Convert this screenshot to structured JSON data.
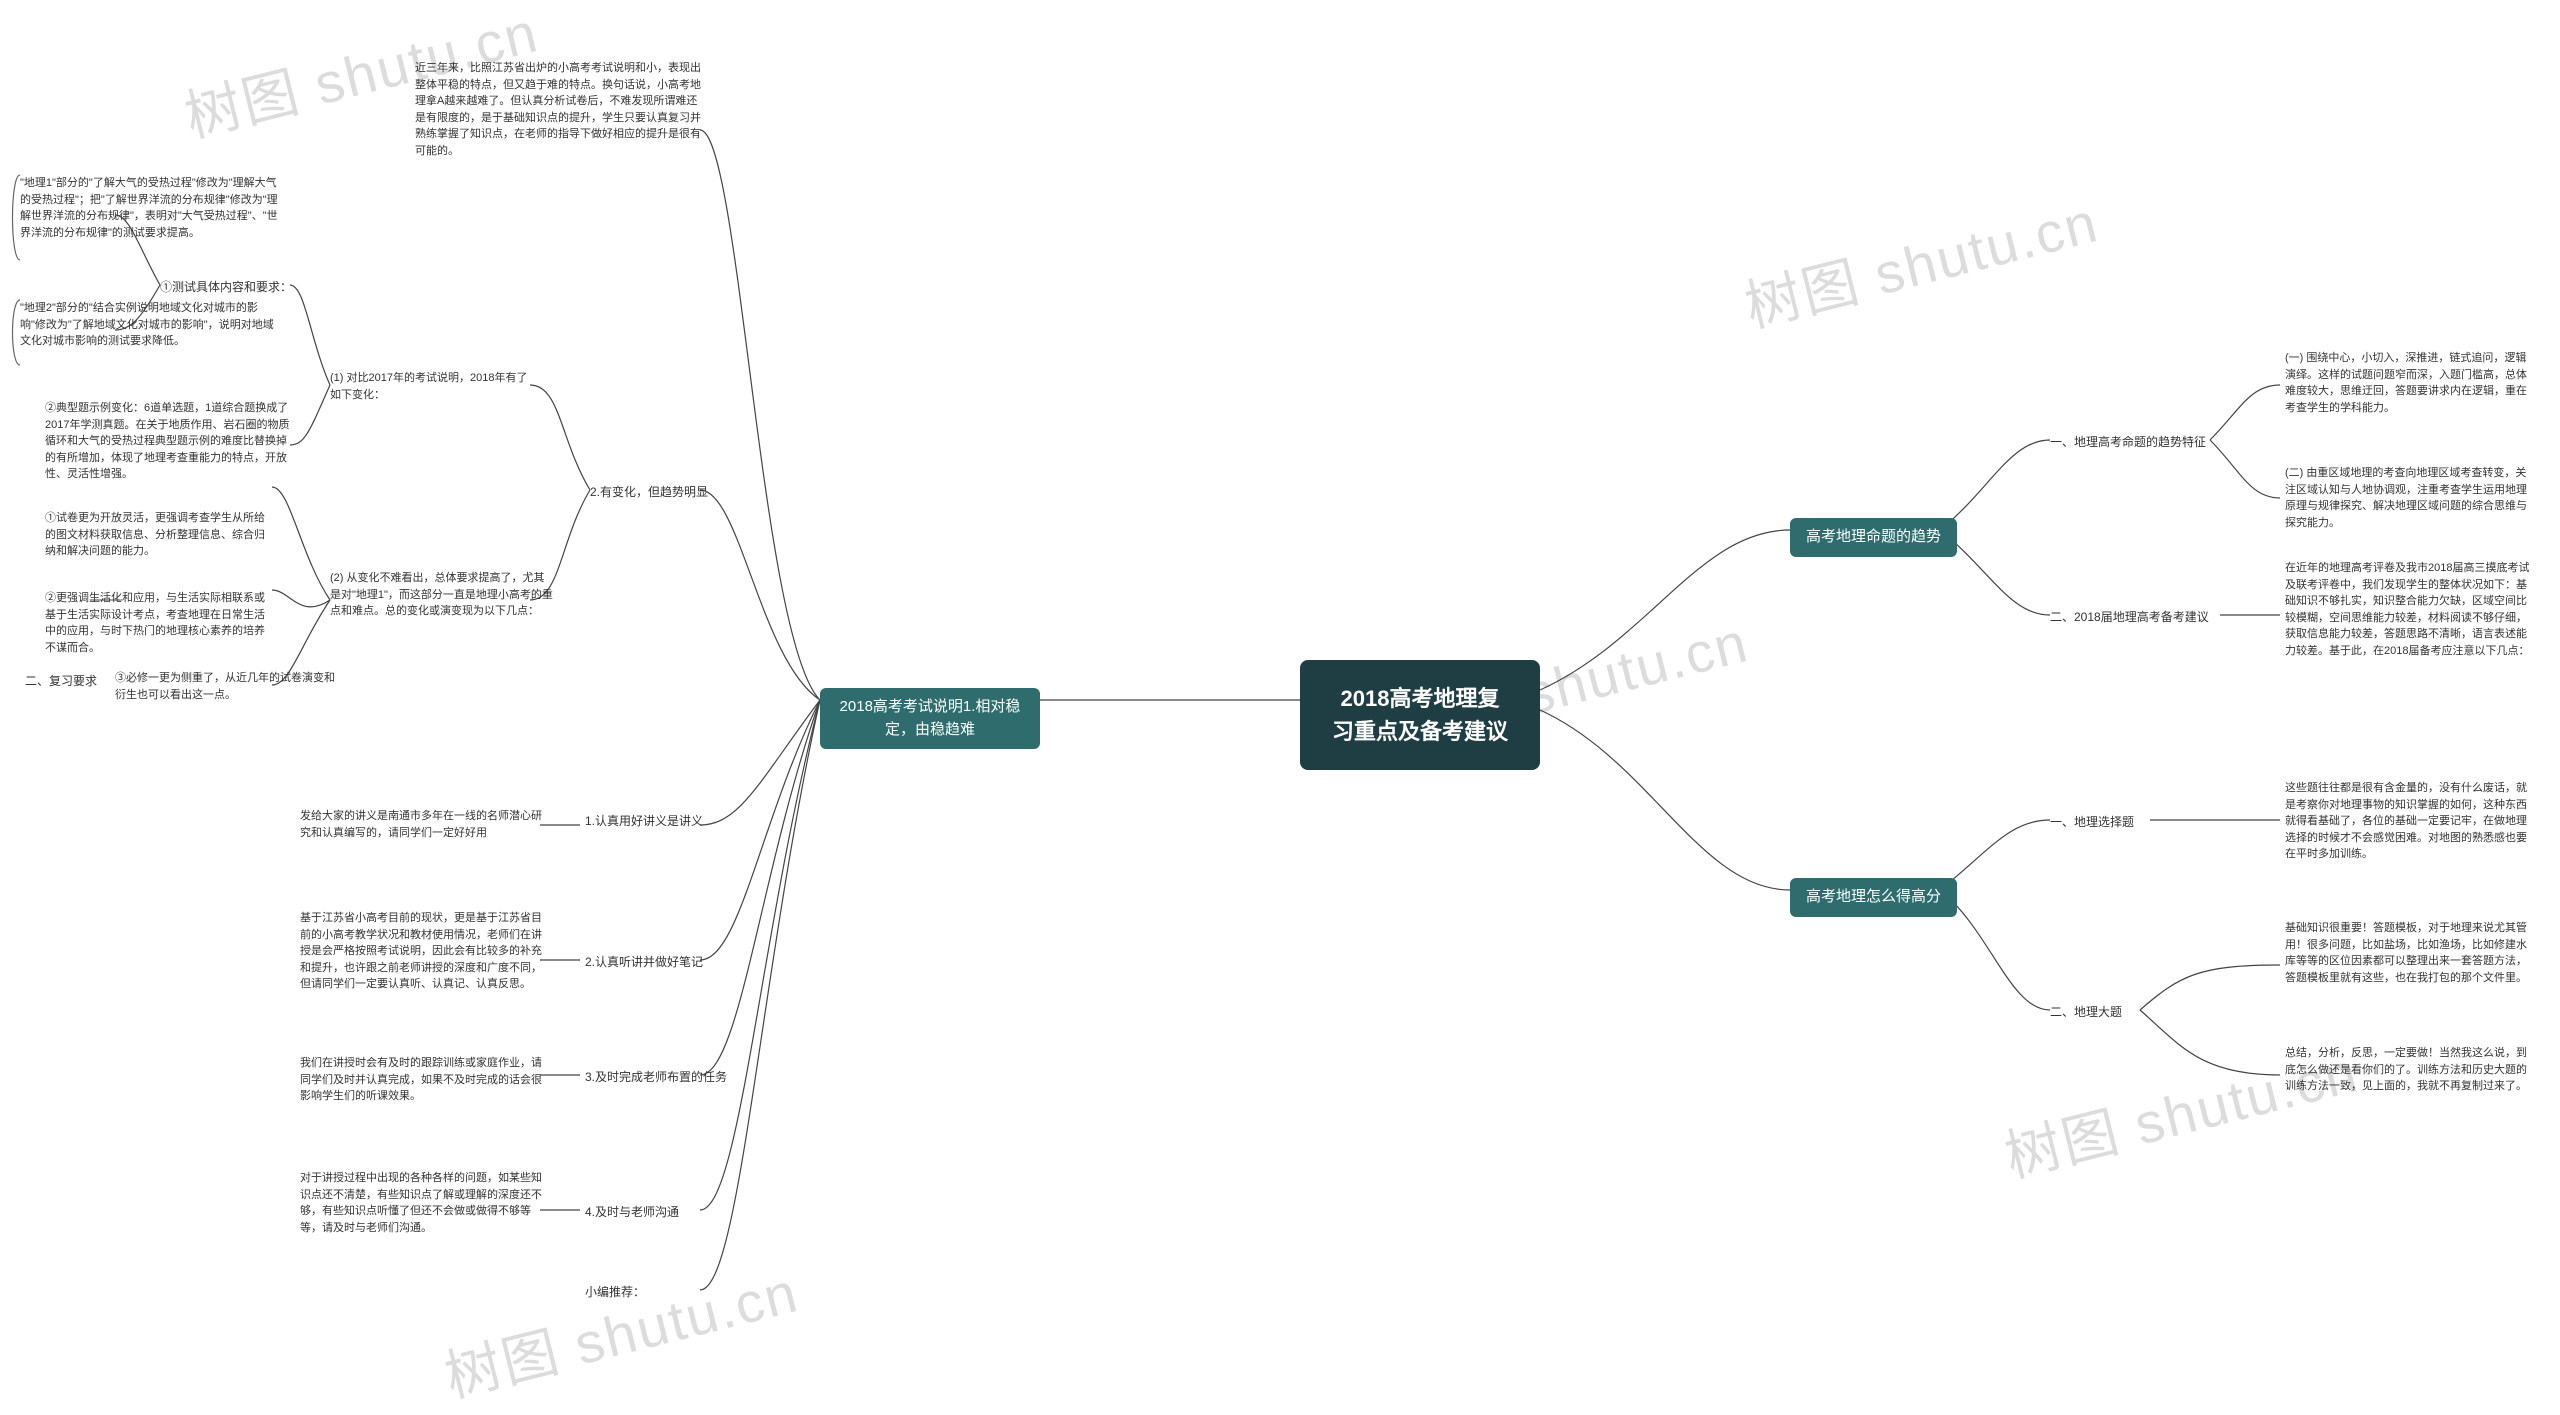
{
  "watermark": "树图 shutu.cn",
  "center": "2018高考地理复习重点及备考建议",
  "left_main": "2018高考考试说明1.相对稳定，由稳趋难",
  "left_a": "近三年来，比照江苏省出炉的小高考考试说明和小，表现出整体平稳的特点，但又趋于难的特点。换句话说，小高考地理拿A越来越难了。但认真分析试卷后，不难发现所谓难还是有限度的，是于基础知识点的提升，学生只要认真复习并熟练掌握了知识点，在老师的指导下做好相应的提升是很有可能的。",
  "left_b": "2.有变化，但趋势明显",
  "left_b1_title": "(1)  对比2017年的考试说明，2018年有了如下变化：",
  "left_b1_a": "①测试具体内容和要求：",
  "left_b1_a_leaf1": "\"地理1\"部分的\"了解大气的受热过程\"修改为\"理解大气的受热过程\"；把\"了解世界洋流的分布规律\"修改为\"理解世界洋流的分布规律\"，表明对\"大气受热过程\"、\"世界洋流的分布规律\"的测试要求提高。",
  "left_b1_a_leaf2": "\"地理2\"部分的\"结合实例说明地域文化对城市的影响\"修改为\"了解地域文化对城市的影响\"，说明对地域文化对城市影响的测试要求降低。",
  "left_b1_b": "②典型题示例变化：6道单选题，1道综合题换成了2017年学测真题。在关于地质作用、岩石圈的物质循环和大气的受热过程典型题示例的难度比替换掉的有所增加，体现了地理考查重能力的特点，开放性、灵活性增强。",
  "left_b2_title": "(2)  从变化不难看出，总体要求提高了，尤其是对\"地理1\"，而这部分一直是地理小高考的重点和难点。总的变化或演变现为以下几点：",
  "left_b2_label": "二、复习要求",
  "left_b2_leaf1": "①试卷更为开放灵活，更强调考查学生从所给的图文材料获取信息、分析整理信息、综合归纳和解决问题的能力。",
  "left_b2_leaf2": "②更强调生活化和应用，与生活实际相联系或基于生活实际设计考点，考查地理在日常生活中的应用，与时下热门的地理核心素养的培养不谋而合。",
  "left_b2_leaf3": "③必修一更为侧重了，从近几年的试卷演变和衍生也可以看出这一点。",
  "left_c1": "1.认真用好讲义是讲义",
  "left_c1_leaf": "发给大家的讲义是南通市多年在一线的名师潜心研究和认真编写的，请同学们一定好好用",
  "left_c2": "2.认真听讲并做好笔记",
  "left_c2_leaf": "基于江苏省小高考目前的现状，更是基于江苏省目前的小高考教学状况和教材使用情况，老师们在讲授是会严格按照考试说明，因此会有比较多的补充和提升，也许跟之前老师讲授的深度和广度不同，但请同学们一定要认真听、认真记、认真反思。",
  "left_c3": "3.及时完成老师布置的任务",
  "left_c3_leaf": "我们在讲授时会有及时的跟踪训练或家庭作业，请同学们及时并认真完成，如果不及时完成的话会很影响学生们的听课效果。",
  "left_c4": "4.及时与老师沟通",
  "left_c4_leaf": "对于讲授过程中出现的各种各样的问题，如某些知识点还不清楚，有些知识点了解或理解的深度还不够，有些知识点听懂了但还不会做或做得不够等等，请及时与老师们沟通。",
  "left_c5": "小编推荐：",
  "right_a": "高考地理命题的趋势",
  "right_a1": "一、地理高考命题的趋势特征",
  "right_a1_leaf1": "(一)  围绕中心，小切入，深推进，链式追问，逻辑演绎。这样的试题问题窄而深，入题门槛高，总体难度较大，思维迂回，答题要讲求内在逻辑，重在考查学生的学科能力。",
  "right_a1_leaf2": "(二)  由重区域地理的考查向地理区域考查转变，关注区域认知与人地协调观，注重考查学生运用地理原理与规律探究、解决地理区域问题的综合思维与探究能力。",
  "right_a2": "二、2018届地理高考备考建议",
  "right_a2_leaf": "在近年的地理高考评卷及我市2018届高三摸底考试及联考评卷中，我们发现学生的整体状况如下：基础知识不够扎实，知识整合能力欠缺，区域空间比较模糊，空间思维能力较差，材料阅读不够仔细，获取信息能力较差，答题思路不清晰，语言表述能力较差。基于此，在2018届备考应注意以下几点：",
  "right_b": "高考地理怎么得高分",
  "right_b1": "一、地理选择题",
  "right_b1_leaf": "这些题往往都是很有含金量的，没有什么废话，就是考察你对地理事物的知识掌握的如何，这种东西就得看基础了，各位的基础一定要记牢，在做地理选择的时候才不会感觉困难。对地图的熟悉感也要在平时多加训练。",
  "right_b2": "二、地理大题",
  "right_b2_leaf1": "基础知识很重要！答题模板，对于地理来说尤其管用！很多问题，比如盐场，比如渔场，比如修建水库等等的区位因素都可以整理出来一套答题方法，答题模板里就有这些，也在我打包的那个文件里。",
  "right_b2_leaf2": "总结，分析，反思，一定要做！当然我这么说，到底怎么做还是看你们的了。训练方法和历史大题的训练方法一致，见上面的，我就不再复制过来了。"
}
